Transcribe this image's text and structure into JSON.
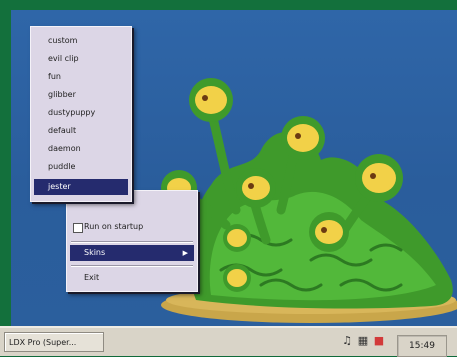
{
  "skin_menu": {
    "items": [
      "custom",
      "evil clip",
      "fun",
      "glibber",
      "dustypuppy",
      "default",
      "daemon",
      "puddle",
      "jester"
    ],
    "selected_index": 8
  },
  "context_menu": {
    "startup_label": "Run on startup",
    "skins_label": "Skins",
    "exit_label": "Exit"
  },
  "taskbar": {
    "task_label": "LDX Pro (Super...",
    "clock": "15:49"
  }
}
